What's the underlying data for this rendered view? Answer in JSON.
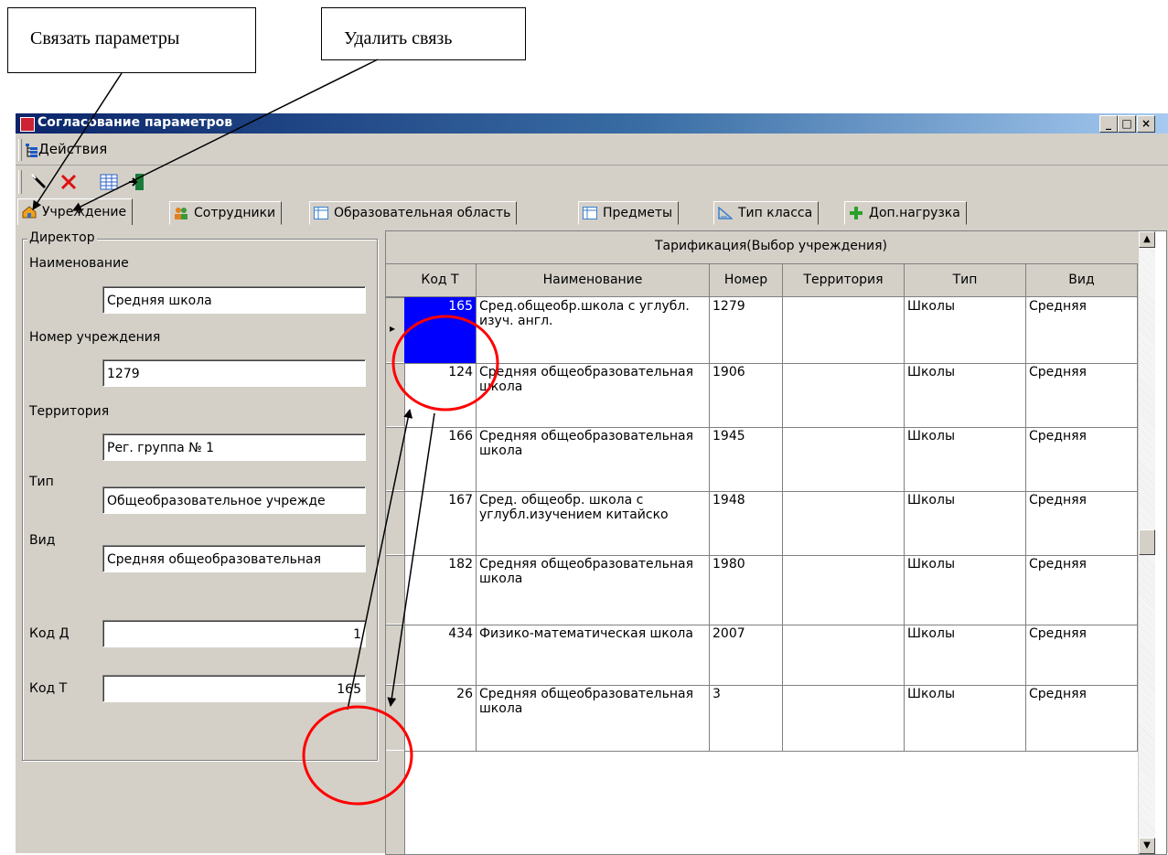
{
  "callouts": {
    "link": "Связать параметры",
    "unlink": "Удалить связь"
  },
  "window": {
    "title": "Согласование параметров",
    "minimize_glyph": "_",
    "maximize_glyph": "□",
    "close_glyph": "×"
  },
  "menu": {
    "actions": "Действия"
  },
  "tabs": [
    {
      "label": "Учреждение"
    },
    {
      "label": "Сотрудники"
    },
    {
      "label": "Образовательная область"
    },
    {
      "label": "Предметы"
    },
    {
      "label": "Тип класса"
    },
    {
      "label": "Доп.нагрузка"
    }
  ],
  "left": {
    "group_title": "Директор",
    "name_label": "Наименование",
    "name_value": "Средняя школа",
    "number_label": "Номер учреждения",
    "number_value": "1279",
    "territory_label": "Территория",
    "territory_value": "Рег. группа № 1",
    "type_label": "Тип",
    "type_value": "Общеобразовательное учрежде",
    "kind_label": "Вид",
    "kind_value": "Средняя общеобразовательная",
    "kod_d_label": "Код Д",
    "kod_d_value": "1",
    "kod_t_label": "Код Т",
    "kod_t_value": "165"
  },
  "grid": {
    "band_title": "Тарификация(Выбор учреждения)",
    "columns": [
      "Код Т",
      "Наименование",
      "Номер",
      "Территория",
      "Тип",
      "Вид"
    ],
    "rows": [
      {
        "kod": "165",
        "name": "Сред.общеобр.школа с углубл. изуч. англ.",
        "number": "1279",
        "territory": "",
        "type": "Школы",
        "kind": "Средняя"
      },
      {
        "kod": "124",
        "name": "Средняя общеобразовательная школа",
        "number": "1906",
        "territory": "",
        "type": "Школы",
        "kind": "Средняя"
      },
      {
        "kod": "166",
        "name": "Средняя общеобразовательная школа",
        "number": "1945",
        "territory": "",
        "type": "Школы",
        "kind": "Средняя"
      },
      {
        "kod": "167",
        "name": "Сред. общеобр. школа с углубл.изучением китайско",
        "number": "1948",
        "territory": "",
        "type": "Школы",
        "kind": "Средняя"
      },
      {
        "kod": "182",
        "name": "Средняя общеобразовательная школа",
        "number": "1980",
        "territory": "",
        "type": "Школы",
        "kind": "Средняя"
      },
      {
        "kod": "434",
        "name": "Физико-математическая школа",
        "number": "2007",
        "territory": "",
        "type": "Школы",
        "kind": "Средняя"
      },
      {
        "kod": "26",
        "name": "Средняя общеобразовательная школа",
        "number": "3",
        "territory": "",
        "type": "Школы",
        "kind": "Средняя"
      }
    ]
  },
  "colors": {
    "title_bar": "#0a246a",
    "selection": "#0000ff",
    "annotation_circle": "#ff0000",
    "face": "#d4d0c8"
  }
}
